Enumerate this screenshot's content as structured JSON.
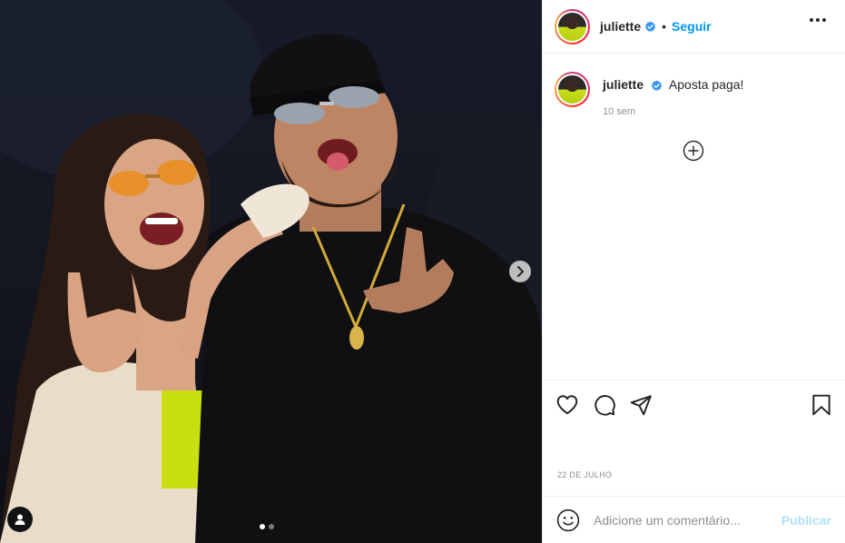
{
  "post": {
    "account": {
      "username": "juliette",
      "verified": true
    },
    "follow_label": "Seguir",
    "separator": "•",
    "caption": {
      "username": "juliette",
      "text": "Aposta paga!"
    },
    "time_ago": "10 sem",
    "date": "22 DE JULHO",
    "carousel": {
      "total": 2,
      "active": 1
    }
  },
  "comment_box": {
    "placeholder": "Adicione um comentário...",
    "publish_label": "Publicar"
  },
  "icons": {
    "verified": "verified-badge-icon",
    "more": "more-options-icon",
    "like": "heart-icon",
    "comment": "comment-bubble-icon",
    "share": "paper-plane-icon",
    "save": "bookmark-icon",
    "emoji": "smiley-icon",
    "load_more": "plus-circle-icon",
    "next": "chevron-right-icon",
    "tag": "user-tag-icon"
  },
  "colors": {
    "accent": "#0095f6",
    "verified": "#3897f0",
    "publish_disabled": "#b2dffc",
    "muted_text": "#8e8e8e",
    "border": "#efefef"
  }
}
